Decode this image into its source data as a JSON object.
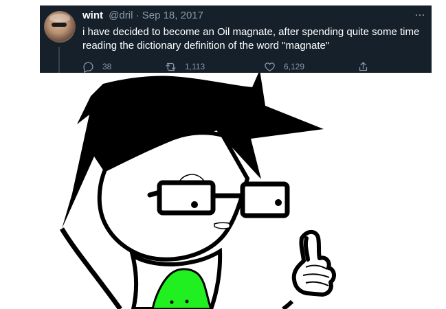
{
  "tweet": {
    "author_name": "wint",
    "handle_date": "@dril · Sep 18, 2017",
    "more_label": "···",
    "text": "i have decided to become an Oil magnate, after spending quite some time reading the dictionary definition of the word \"magnate\"",
    "replies": "38",
    "retweets": "1,113",
    "likes": "6,129"
  },
  "icons": {
    "avatar": "avatar-image",
    "reply": "reply-icon",
    "retweet": "retweet-icon",
    "like": "heart-icon",
    "share": "share-icon"
  },
  "colors": {
    "tweet_background": "#15202b",
    "muted_text": "#8b98a5",
    "primary_text": "#ffffff",
    "drawing_green": "#20f020"
  }
}
